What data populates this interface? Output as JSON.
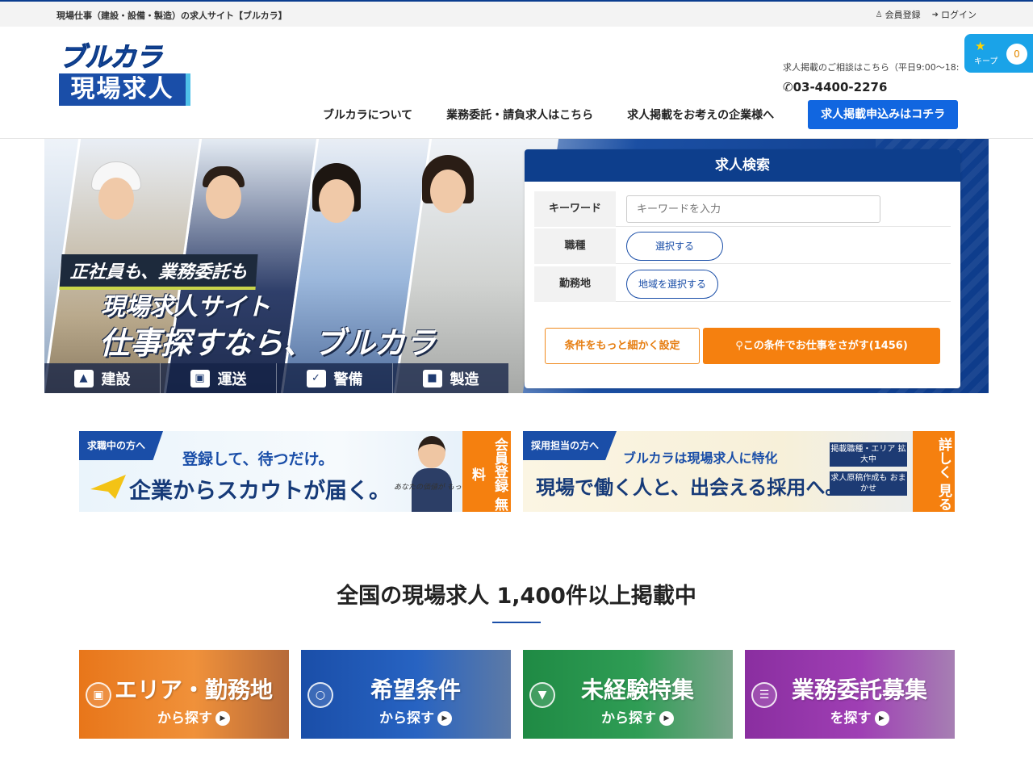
{
  "topbar": {
    "site_desc": "現場仕事（建設・設備・製造）の求人サイト【ブルカラ】",
    "register": "会員登録",
    "login": "ログイン"
  },
  "logo": {
    "line1": "ブルカラ",
    "line2": "現場求人"
  },
  "contact": {
    "label": "求人掲載のご相談はこちら（平日9:00〜18:",
    "phone": "03-4400-2276"
  },
  "keep": {
    "label": "キープ",
    "count": "0"
  },
  "nav": {
    "items": [
      "ブルカラについて",
      "業務委託・請負求人はこちら",
      "求人掲載をお考えの企業様へ"
    ],
    "cta": "求人掲載申込みはコチラ"
  },
  "hero": {
    "catch1": "正社員も、業務委託も",
    "catch2": "現場求人サイト",
    "catch3": "仕事探すなら、ブルカラ",
    "categories": [
      {
        "label": "建設",
        "icon": "crane-icon"
      },
      {
        "label": "運送",
        "icon": "truck-icon"
      },
      {
        "label": "警備",
        "icon": "shield-icon"
      },
      {
        "label": "製造",
        "icon": "factory-icon"
      }
    ]
  },
  "search": {
    "title": "求人検索",
    "keyword_label": "キーワード",
    "keyword_placeholder": "キーワードを入力",
    "job_label": "職種",
    "job_button": "選択する",
    "area_label": "勤務地",
    "area_button": "地域を選択する",
    "more_button": "条件をもっと細かく設定",
    "go_button": "この条件でお仕事をさがす(1456)"
  },
  "banners": {
    "seeker": {
      "tag": "求職中の方へ",
      "sub": "登録して、待つだけ。",
      "main": "企業からスカウトが届く。",
      "note": "あなたの価値が もっと輝く",
      "side": "会員登録 無料"
    },
    "employer": {
      "tag": "採用担当の方へ",
      "sub": "ブルカラは現場求人に特化",
      "main": "現場で働く人と、出会える採用へ。",
      "box1": "掲載職種・エリア 拡大中",
      "box2": "求人原稿作成も おまかせ",
      "side": "詳しく 見る"
    }
  },
  "section": {
    "title": "全国の現場求人 1,400件以上掲載中"
  },
  "cards": [
    {
      "title": "エリア・勤務地",
      "sub": "から探す",
      "icon": "map-icon",
      "color": "#e8761a"
    },
    {
      "title": "希望条件",
      "sub": "から探す",
      "icon": "helmet-icon",
      "color": "#1a4ea8"
    },
    {
      "title": "未経験特集",
      "sub": "から探す",
      "icon": "beginner-icon",
      "color": "#1f8a44"
    },
    {
      "title": "業務委託募集",
      "sub": "を探す",
      "icon": "document-icon",
      "color": "#8a2ea0"
    }
  ]
}
